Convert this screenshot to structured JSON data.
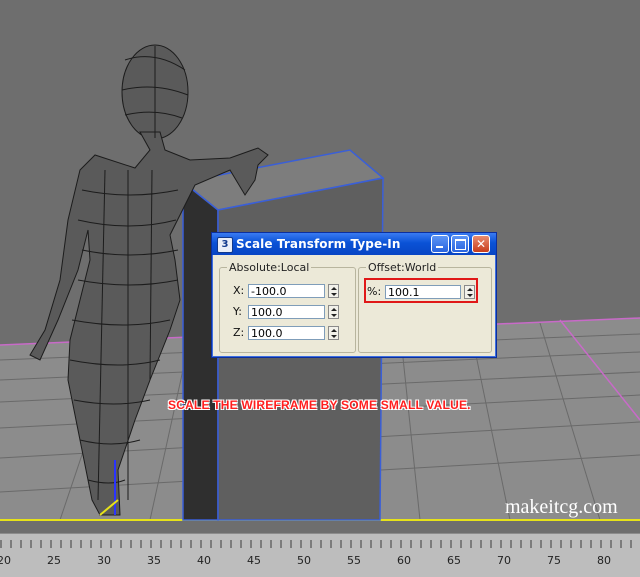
{
  "dialog": {
    "title": "Scale Transform Type-In",
    "absolute_group": {
      "title": "Absolute:Local",
      "fields": [
        {
          "label": "X:",
          "value": "-100.0"
        },
        {
          "label": "Y:",
          "value": "100.0"
        },
        {
          "label": "Z:",
          "value": "100.0"
        }
      ]
    },
    "offset_group": {
      "title": "Offset:World",
      "fields": [
        {
          "label": "%:",
          "value": "100.1"
        }
      ]
    }
  },
  "caption": "SCALE THE WIREFRAME BY SOME SMALL VALUE.",
  "watermark": "makeitcg.com",
  "ruler": {
    "labels": [
      "20",
      "25",
      "30",
      "35",
      "40",
      "45",
      "50",
      "55",
      "60",
      "65",
      "70",
      "75",
      "80"
    ]
  },
  "colors": {
    "viewport_bg": "#6e6e6e",
    "caption": "#ff1e1e",
    "highlight": "#e01818",
    "title_bar": "#0a52d6"
  }
}
